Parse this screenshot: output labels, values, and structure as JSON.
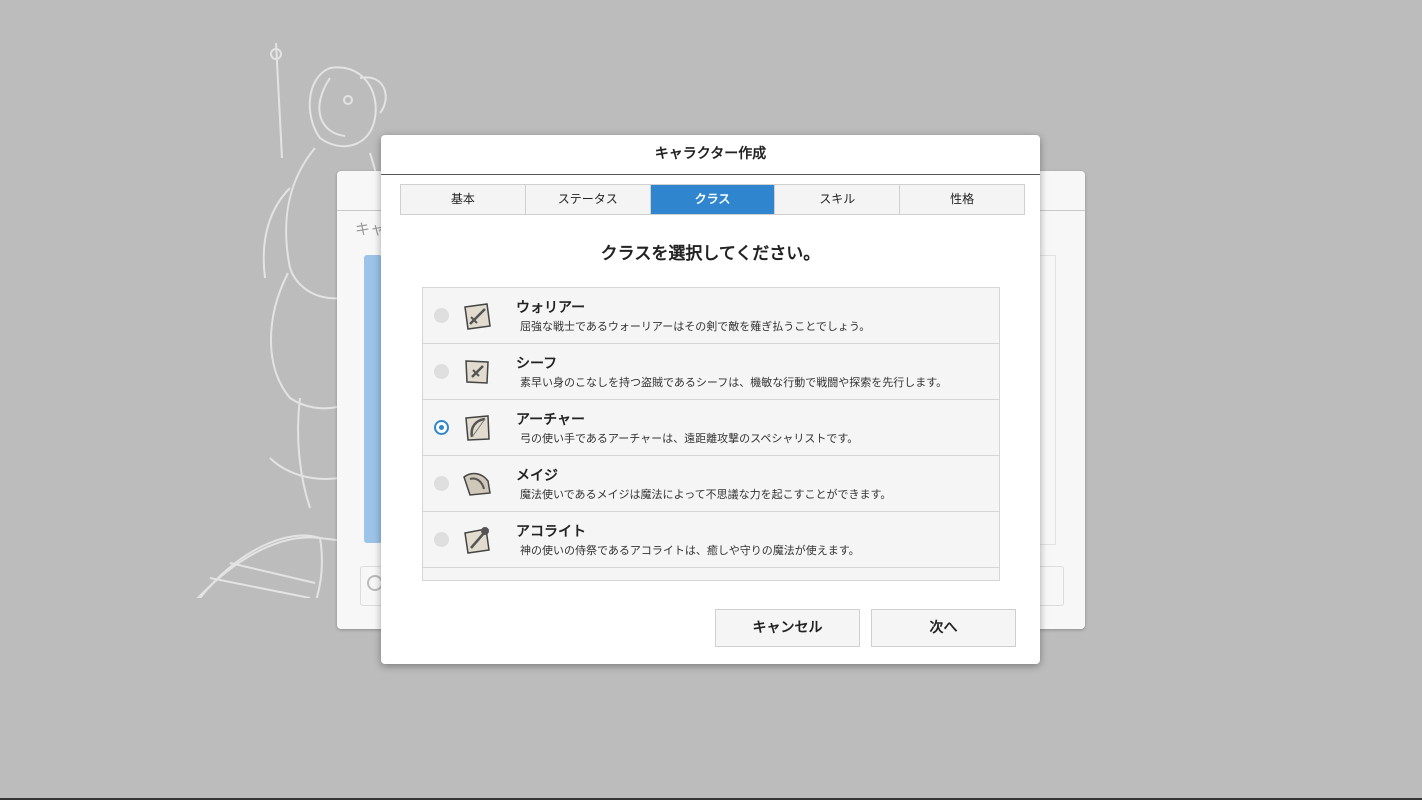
{
  "dialog": {
    "title": "キャラクター作成",
    "tabs": [
      {
        "label": "基本",
        "active": false
      },
      {
        "label": "ステータス",
        "active": false
      },
      {
        "label": "クラス",
        "active": true
      },
      {
        "label": "スキル",
        "active": false
      },
      {
        "label": "性格",
        "active": false
      }
    ],
    "prompt": "クラスを選択してください。",
    "classes": [
      {
        "name": "ウォリアー",
        "description": "屈強な戦士であるウォーリアーはその剣で敵を薙ぎ払うことでしょう。",
        "selected": false,
        "icon": "sword-icon"
      },
      {
        "name": "シーフ",
        "description": "素早い身のこなしを持つ盗賊であるシーフは、機敏な行動で戦闘や探索を先行します。",
        "selected": false,
        "icon": "dagger-icon"
      },
      {
        "name": "アーチャー",
        "description": "弓の使い手であるアーチャーは、遠距離攻撃のスペシャリストです。",
        "selected": true,
        "icon": "bow-icon"
      },
      {
        "name": "メイジ",
        "description": "魔法使いであるメイジは魔法によって不思議な力を起こすことができます。",
        "selected": false,
        "icon": "mage-hat-icon"
      },
      {
        "name": "アコライト",
        "description": "神の使いの侍祭であるアコライトは、癒しや守りの魔法が使えます。",
        "selected": false,
        "icon": "mace-icon"
      }
    ],
    "buttons": {
      "cancel": "キャンセル",
      "next": "次へ"
    }
  },
  "background_panel": {
    "title_fragment": "キャ"
  },
  "colors": {
    "accent": "#2f86cf",
    "backdrop": "#bcbcbc",
    "panel_blue": "#9cc3e8"
  }
}
